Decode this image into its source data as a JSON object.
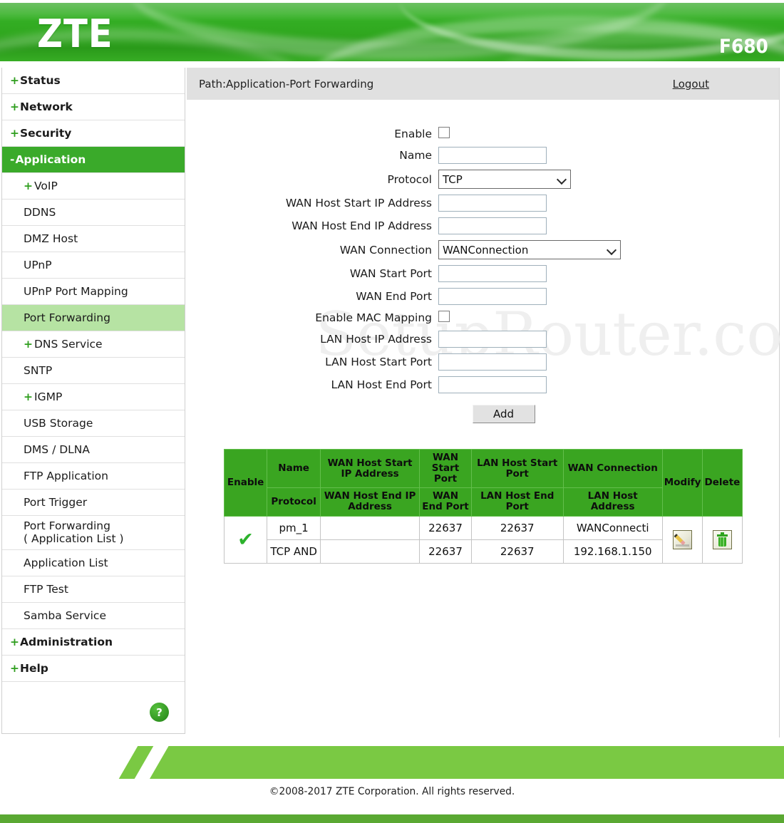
{
  "header": {
    "brand": "ZTE",
    "model": "F680"
  },
  "sidebar": {
    "items": [
      {
        "label": "Status",
        "sign": "+",
        "level": "top",
        "state": "normal"
      },
      {
        "label": "Network",
        "sign": "+",
        "level": "top",
        "state": "normal"
      },
      {
        "label": "Security",
        "sign": "+",
        "level": "top",
        "state": "normal"
      },
      {
        "label": "Application",
        "sign": "-",
        "level": "top",
        "state": "active"
      },
      {
        "label": "VoIP",
        "sign": "+",
        "level": "sub",
        "state": "normal"
      },
      {
        "label": "DDNS",
        "sign": "",
        "level": "sub",
        "state": "normal"
      },
      {
        "label": "DMZ Host",
        "sign": "",
        "level": "sub",
        "state": "normal"
      },
      {
        "label": "UPnP",
        "sign": "",
        "level": "sub",
        "state": "normal"
      },
      {
        "label": "UPnP Port Mapping",
        "sign": "",
        "level": "sub",
        "state": "normal"
      },
      {
        "label": "Port Forwarding",
        "sign": "",
        "level": "sub",
        "state": "highlight"
      },
      {
        "label": "DNS Service",
        "sign": "+",
        "level": "sub",
        "state": "normal"
      },
      {
        "label": "SNTP",
        "sign": "",
        "level": "sub",
        "state": "normal"
      },
      {
        "label": "IGMP",
        "sign": "+",
        "level": "sub",
        "state": "normal"
      },
      {
        "label": "USB Storage",
        "sign": "",
        "level": "sub",
        "state": "normal"
      },
      {
        "label": "DMS / DLNA",
        "sign": "",
        "level": "sub",
        "state": "normal"
      },
      {
        "label": "FTP Application",
        "sign": "",
        "level": "sub",
        "state": "normal"
      },
      {
        "label": "Port Trigger",
        "sign": "",
        "level": "sub",
        "state": "normal"
      },
      {
        "label": "Port Forwarding\n( Application List )",
        "sign": "",
        "level": "sub",
        "state": "normal"
      },
      {
        "label": "Application List",
        "sign": "",
        "level": "sub",
        "state": "normal"
      },
      {
        "label": "FTP Test",
        "sign": "",
        "level": "sub",
        "state": "normal"
      },
      {
        "label": "Samba Service",
        "sign": "",
        "level": "sub",
        "state": "normal"
      },
      {
        "label": "Administration",
        "sign": "+",
        "level": "top",
        "state": "normal"
      },
      {
        "label": "Help",
        "sign": "+",
        "level": "top",
        "state": "normal"
      }
    ],
    "help_icon": "?"
  },
  "pathbar": {
    "path": "Path:Application-Port Forwarding",
    "logout": "Logout"
  },
  "watermark": "SetupRouter.com",
  "form": {
    "fields": [
      {
        "label": "Enable",
        "type": "checkbox",
        "checked": false
      },
      {
        "label": "Name",
        "type": "text",
        "value": ""
      },
      {
        "label": "Protocol",
        "type": "select",
        "value": "TCP"
      },
      {
        "label": "WAN Host Start IP Address",
        "type": "text",
        "value": ""
      },
      {
        "label": "WAN Host End IP Address",
        "type": "text",
        "value": ""
      },
      {
        "label": "WAN Connection",
        "type": "select",
        "value": "WANConnection"
      },
      {
        "label": "WAN Start Port",
        "type": "text",
        "value": ""
      },
      {
        "label": "WAN End Port",
        "type": "text",
        "value": ""
      },
      {
        "label": "Enable MAC Mapping",
        "type": "checkbox",
        "checked": false
      },
      {
        "label": "LAN Host IP Address",
        "type": "text",
        "value": ""
      },
      {
        "label": "LAN Host Start Port",
        "type": "text",
        "value": ""
      },
      {
        "label": "LAN Host End Port",
        "type": "text",
        "value": ""
      }
    ],
    "add_button": "Add"
  },
  "table": {
    "headers_row1": {
      "enable": "Enable",
      "name": "Name",
      "wan_host_start_ip": "WAN Host Start IP Address",
      "wan_start_port": "WAN Start Port",
      "lan_host_start_port": "LAN Host Start Port",
      "wan_connection": "WAN Connection",
      "modify": "Modify",
      "delete": "Delete"
    },
    "headers_row2": {
      "protocol": "Protocol",
      "wan_host_end_ip": "WAN Host End IP Address",
      "wan_end_port": "WAN End Port",
      "lan_host_end_port": "LAN Host End Port",
      "lan_host_address": "LAN Host Address"
    },
    "rows": [
      {
        "enable": "✔",
        "name": "pm_1",
        "wan_host_start_ip": "",
        "wan_start_port": "22637",
        "lan_host_start_port": "22637",
        "wan_connection": "WANConnecti",
        "protocol": "TCP AND",
        "wan_host_end_ip": "",
        "wan_end_port": "22637",
        "lan_host_end_port": "22637",
        "lan_host_address": "192.168.1.150"
      }
    ]
  },
  "footer": {
    "copyright": "©2008-2017 ZTE Corporation. All rights reserved."
  },
  "colors": {
    "brand_green": "#3aaa2a",
    "header_green": "#30a81f",
    "highlight_green": "#b6e3a3",
    "footer_green": "#7ac943",
    "footer_bar": "#5aa832",
    "table_header": "#3aa521",
    "path_gray": "#e0e0e0"
  }
}
